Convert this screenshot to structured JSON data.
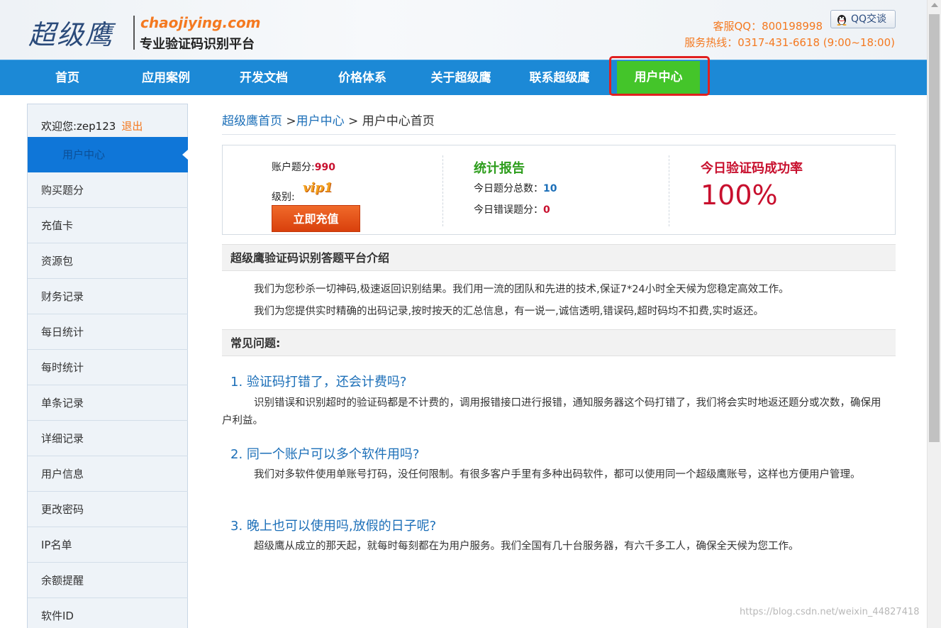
{
  "header": {
    "logo_script": "超级鹰",
    "logo_domain": "chaojiying.com",
    "logo_tagline": "专业验证码识别平台",
    "qq_service": "客服QQ：800198998",
    "qq_button": "QQ交谈",
    "hotline": "服务热线：0317-431-6618 (9:00~18:00)"
  },
  "nav": {
    "items": [
      "首页",
      "应用案例",
      "开发文档",
      "价格体系",
      "关于超级鹰",
      "联系超级鹰",
      "用户中心"
    ]
  },
  "sidebar": {
    "welcome": "欢迎您:zep123",
    "logout": "退出",
    "active": "用户中心",
    "items": [
      "购买题分",
      "充值卡",
      "资源包",
      "财务记录",
      "每日统计",
      "每时统计",
      "单条记录",
      "详细记录",
      "用户信息",
      "更改密码",
      "IP名单",
      "余额提醒",
      "软件ID"
    ]
  },
  "breadcrumb": {
    "home": "超级鹰首页",
    "sep1": " >",
    "center": "用户中心",
    "sep2": " > ",
    "current": "用户中心首页"
  },
  "account": {
    "points_label": "账户题分:",
    "points": "990",
    "level_label": "级别:",
    "level": "vip1",
    "recharge": "立即充值"
  },
  "report": {
    "title": "统计报告",
    "total_label": "今日题分总数：",
    "total": "10",
    "error_label": "今日错误题分：",
    "error": "0"
  },
  "success": {
    "title": "今日验证码成功率",
    "rate": "100%"
  },
  "intro": {
    "title": "超级鹰验证码识别答题平台介绍",
    "p1": "我们为您秒杀一切神码,极速返回识别结果。我们用一流的团队和先进的技术,保证7*24小时全天候为您稳定高效工作。",
    "p2": "我们为您提供实时精确的出码记录,按时按天的汇总信息，有一说一,诚信透明,错误码,超时码均不扣费,实时返还。"
  },
  "faq": {
    "title": "常见问题:",
    "q1": "1. 验证码打错了，还会计费吗?",
    "a1": "识别错误和识别超时的验证码都是不计费的，调用报错接口进行报错，通知服务器这个码打错了，我们将会实时地返还题分或次数，确保用户利益。",
    "q2": "2. 同一个账户可以多个软件用吗?",
    "a2": "我们对多软件使用单账号打码，没任何限制。有很多客户手里有多种出码软件，都可以使用同一个超级鹰账号，这样也方便用户管理。",
    "q3": "3. 晚上也可以使用吗,放假的日子呢?",
    "a3": "超级鹰从成立的那天起，就每时每刻都在为用户服务。我们全国有几十台服务器，有六千多工人，确保全天候为您工作。"
  },
  "watermark": "https://blog.csdn.net/weixin_44827418",
  "colors": {
    "nav_bg": "#1c89d6",
    "nav_active": "#44c52a",
    "accent_orange": "#f47920",
    "link_blue": "#1c6fb8",
    "red": "#c8102e",
    "green": "#2d9d1c"
  }
}
